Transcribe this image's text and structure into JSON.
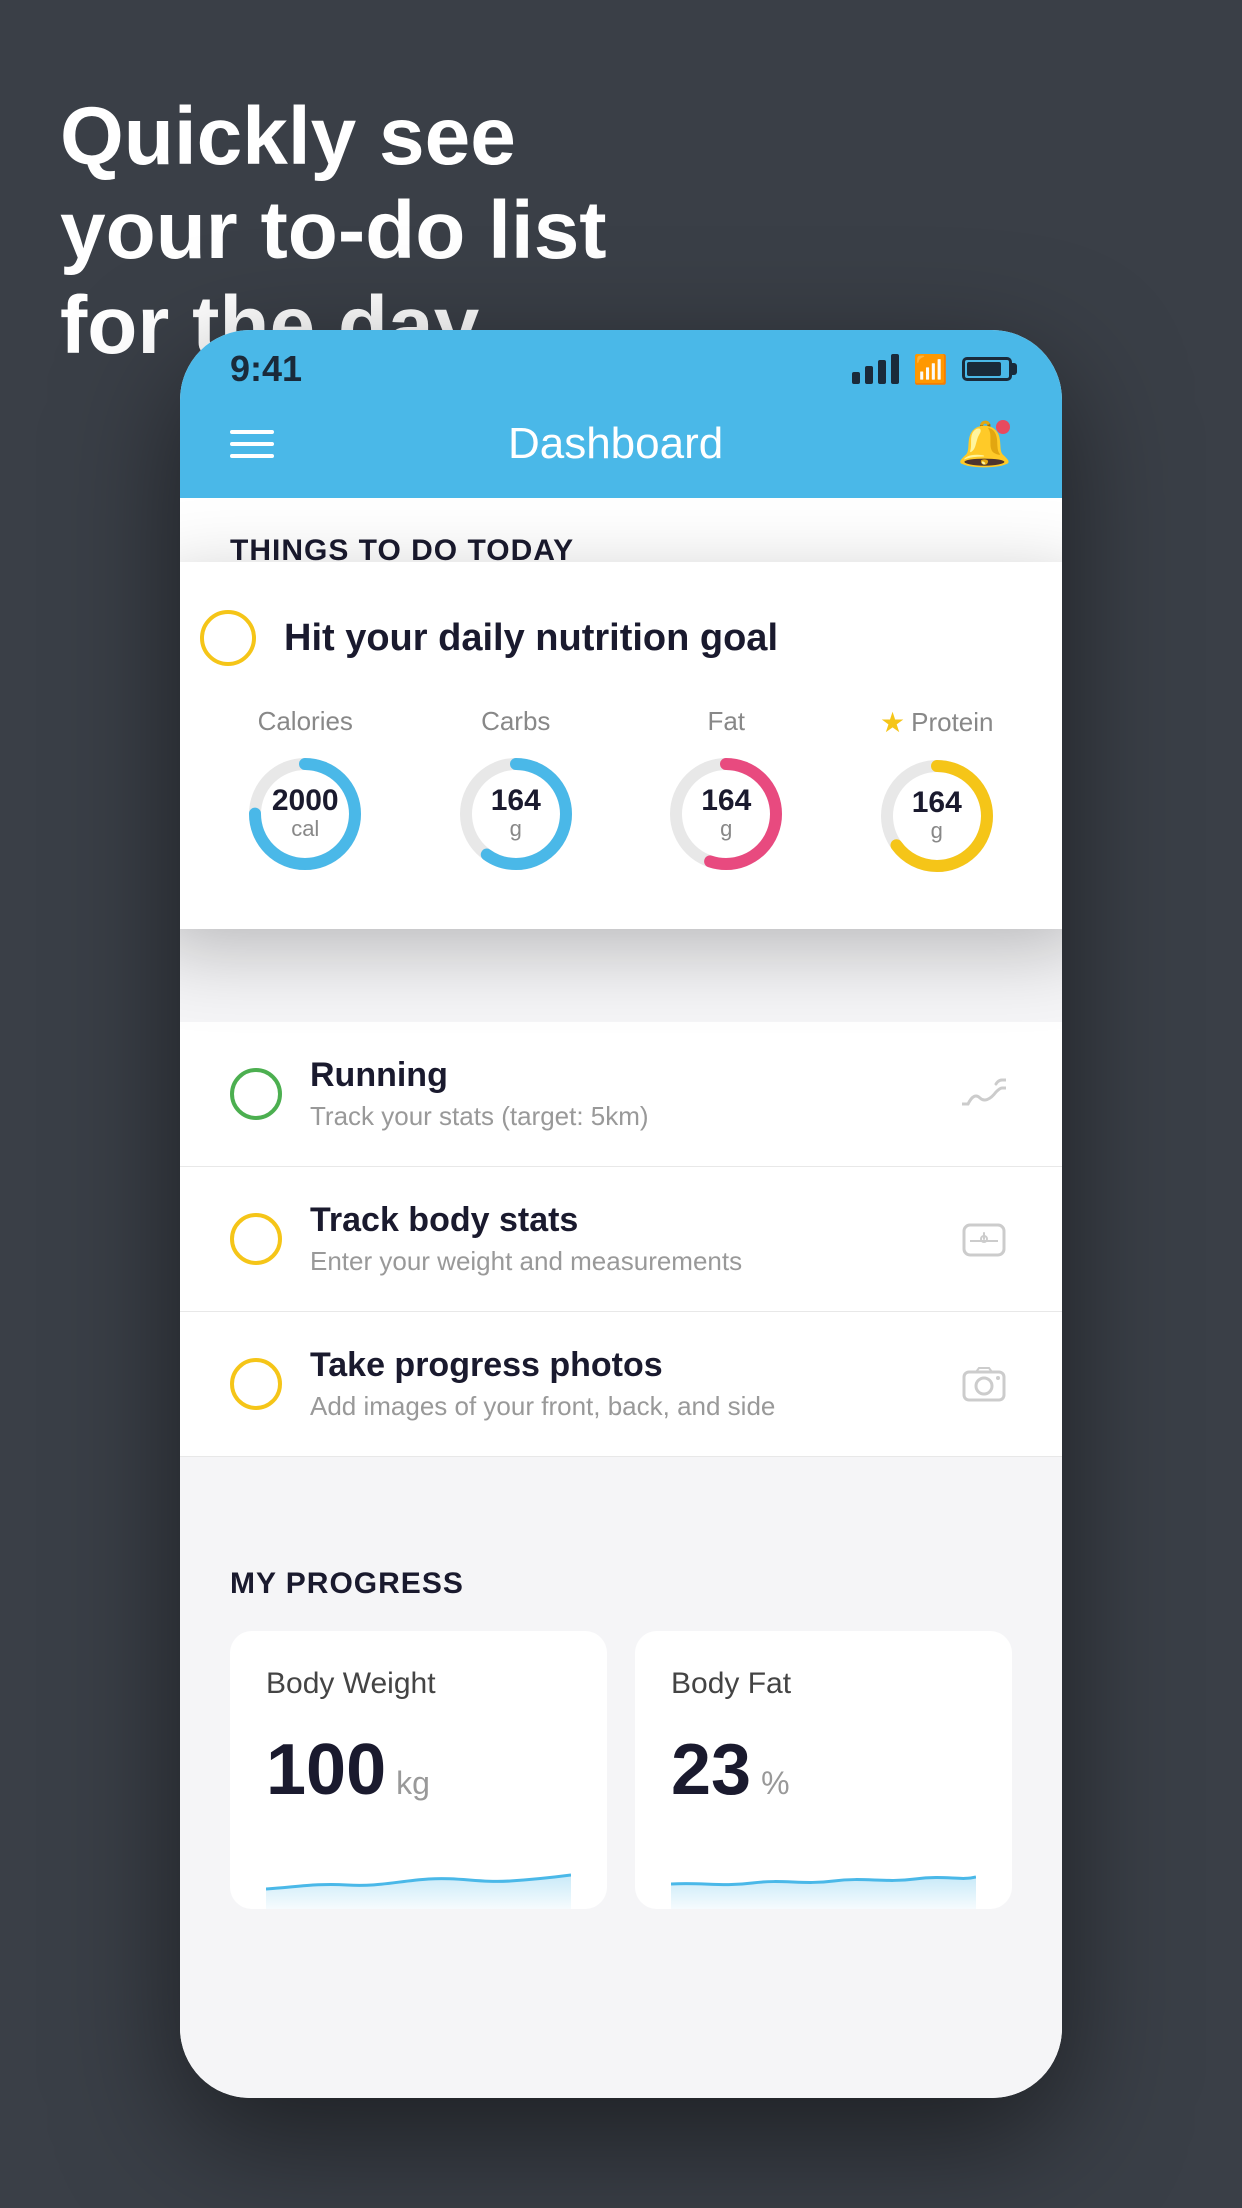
{
  "headline": {
    "line1": "Quickly see",
    "line2": "your to-do list",
    "line3": "for the day."
  },
  "status_bar": {
    "time": "9:41"
  },
  "nav": {
    "title": "Dashboard"
  },
  "things_header": "THINGS TO DO TODAY",
  "floating_card": {
    "title": "Hit your daily nutrition goal",
    "nutrients": [
      {
        "label": "Calories",
        "value": "2000",
        "unit": "cal",
        "color": "#4ab8e8",
        "track": 75
      },
      {
        "label": "Carbs",
        "value": "164",
        "unit": "g",
        "color": "#4ab8e8",
        "track": 60
      },
      {
        "label": "Fat",
        "value": "164",
        "unit": "g",
        "color": "#e84a7f",
        "track": 55
      },
      {
        "label": "Protein",
        "value": "164",
        "unit": "g",
        "color": "#f5c518",
        "track": 65,
        "starred": true
      }
    ]
  },
  "list_items": [
    {
      "title": "Running",
      "subtitle": "Track your stats (target: 5km)",
      "circle_color": "green",
      "icon": "shoe"
    },
    {
      "title": "Track body stats",
      "subtitle": "Enter your weight and measurements",
      "circle_color": "yellow",
      "icon": "scale"
    },
    {
      "title": "Take progress photos",
      "subtitle": "Add images of your front, back, and side",
      "circle_color": "yellow",
      "icon": "photo"
    }
  ],
  "progress": {
    "header": "MY PROGRESS",
    "cards": [
      {
        "title": "Body Weight",
        "value": "100",
        "unit": "kg"
      },
      {
        "title": "Body Fat",
        "value": "23",
        "unit": "%"
      }
    ]
  }
}
